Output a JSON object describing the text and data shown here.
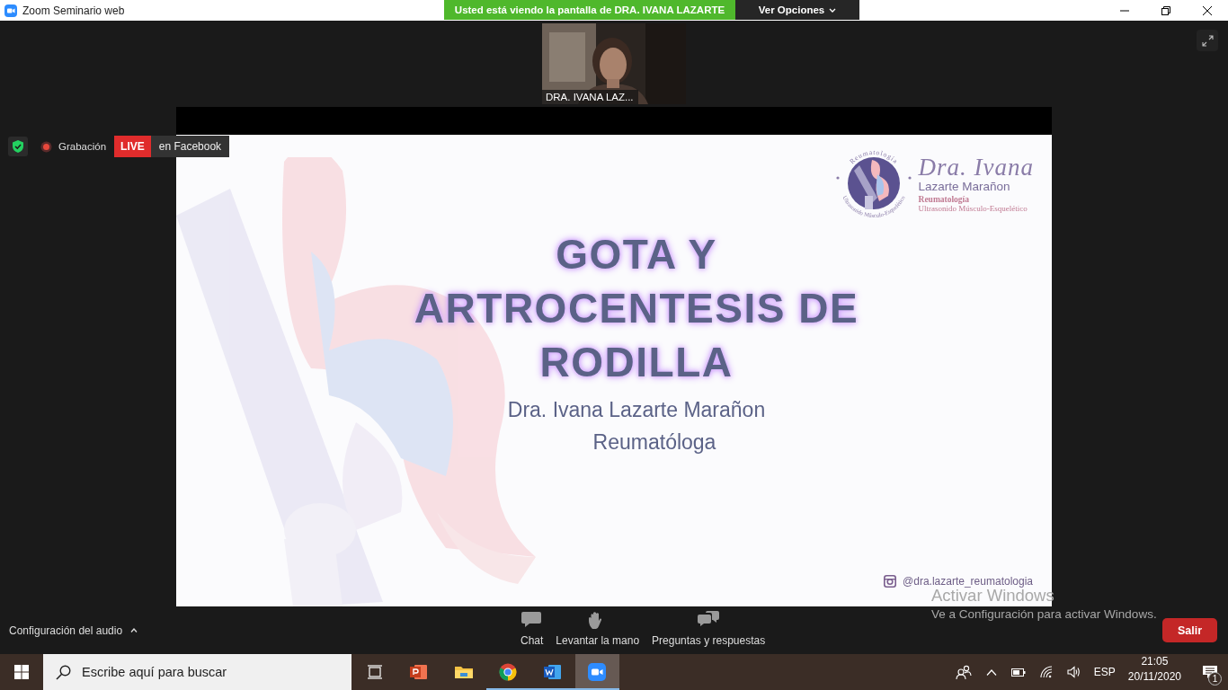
{
  "window": {
    "title": "Zoom Seminario web"
  },
  "share_banner": {
    "text": "Usted está viendo la pantalla de DRA. IVANA LAZARTE",
    "options_button": "Ver Opciones"
  },
  "video": {
    "name": "DRA. IVANA LAZ..."
  },
  "status": {
    "recording": "Grabación",
    "live_badge": "LIVE",
    "live_target": "en Facebook"
  },
  "slide": {
    "logo": {
      "ring_top": "Reumatología",
      "ring_bottom": "Ultrasonido Músculo-Esquelético",
      "script_name": "Dra. Ivana",
      "surname": "Lazarte Marañon",
      "specialty": "Reumatología",
      "subspecialty": "Ultrasonido Músculo-Esquelético"
    },
    "title_lines": [
      "GOTA Y",
      "ARTROCENTESIS DE",
      "RODILLA"
    ],
    "author": "Dra. Ivana Lazarte Marañon",
    "role": "Reumatóloga",
    "instagram": "@dra.lazarte_reumatologia"
  },
  "audio_settings": "Configuración del audio",
  "actions": [
    {
      "kind": "chat",
      "label": "Chat"
    },
    {
      "kind": "hand",
      "label": "Levantar la mano"
    },
    {
      "kind": "qa",
      "label": "Preguntas y respuestas"
    }
  ],
  "leave_button": "Salir",
  "activation_notice": {
    "title": "Activar Windows",
    "text": "Ve a Configuración para activar Windows."
  },
  "taskbar": {
    "search_placeholder": "Escribe aquí para buscar",
    "apps": [
      {
        "kind": "taskview",
        "running": false,
        "active": false
      },
      {
        "kind": "powerpoint",
        "running": false,
        "active": false
      },
      {
        "kind": "explorer",
        "running": false,
        "active": false
      },
      {
        "kind": "chrome",
        "running": true,
        "active": false
      },
      {
        "kind": "word",
        "running": true,
        "active": false
      },
      {
        "kind": "zoom",
        "running": true,
        "active": true
      }
    ],
    "language": "ESP",
    "time": "21:05",
    "date": "20/11/2020",
    "notifications": "1"
  }
}
